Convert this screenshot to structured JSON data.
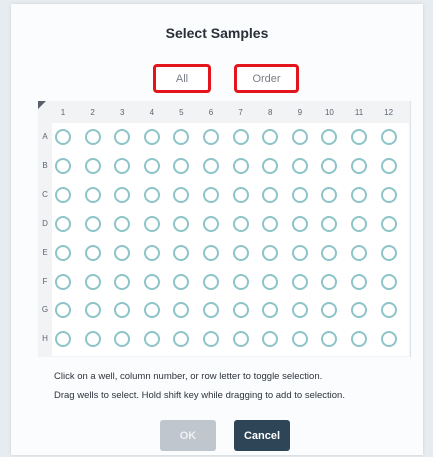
{
  "dialog": {
    "title": "Select Samples",
    "all_label": "All",
    "order_label": "Order",
    "columns": [
      "1",
      "2",
      "3",
      "4",
      "5",
      "6",
      "7",
      "8",
      "9",
      "10",
      "11",
      "12"
    ],
    "rows": [
      "A",
      "B",
      "C",
      "D",
      "E",
      "F",
      "G",
      "H"
    ],
    "help_line1": "Click on a well, column number, or row letter to toggle selection.",
    "help_line2": "Drag wells to select. Hold shift key while dragging to add to selection.",
    "ok_label": "OK",
    "cancel_label": "Cancel",
    "ok_enabled": false,
    "selected_wells": []
  },
  "colors": {
    "highlight_border": "#e3141b",
    "well_stroke": "#8dc4c8",
    "cancel_bg": "#2d4556",
    "ok_disabled_bg": "#bfc6cd"
  }
}
